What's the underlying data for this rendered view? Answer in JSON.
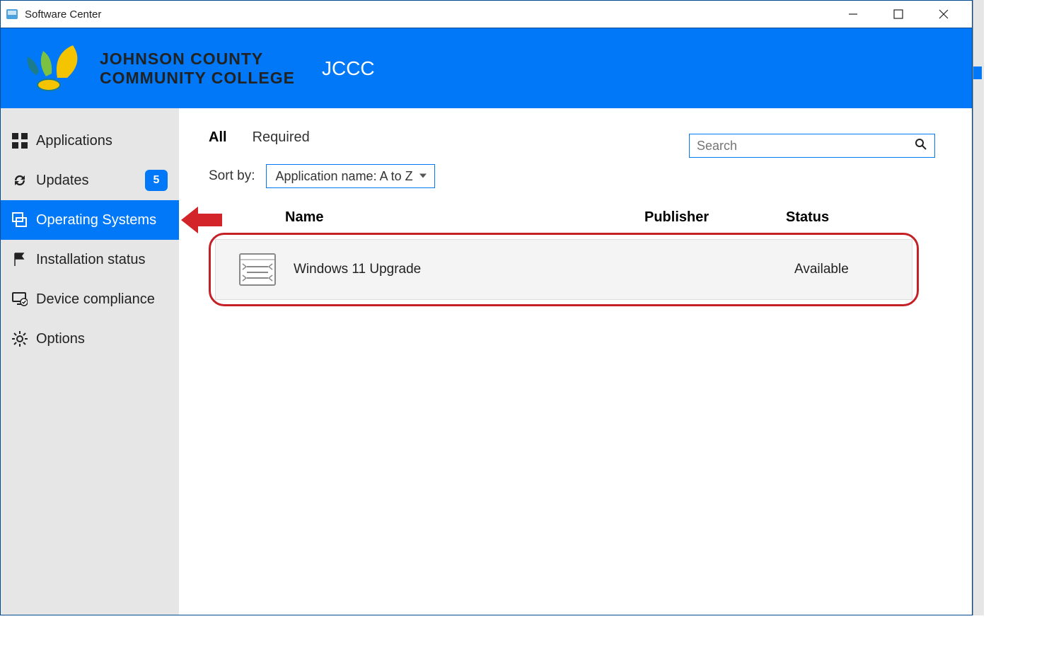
{
  "window": {
    "title": "Software Center"
  },
  "banner": {
    "logo_main": "JOHNSON COUNTY",
    "logo_sub": "COMMUNITY COLLEGE",
    "org": "JCCC"
  },
  "sidebar": {
    "items": [
      {
        "label": "Applications",
        "icon": "apps-grid-icon",
        "active": false,
        "badge": null
      },
      {
        "label": "Updates",
        "icon": "refresh-icon",
        "active": false,
        "badge": "5"
      },
      {
        "label": "Operating Systems",
        "icon": "os-stack-icon",
        "active": true,
        "badge": null
      },
      {
        "label": "Installation status",
        "icon": "flag-icon",
        "active": false,
        "badge": null
      },
      {
        "label": "Device compliance",
        "icon": "monitor-check-icon",
        "active": false,
        "badge": null
      },
      {
        "label": "Options",
        "icon": "gear-icon",
        "active": false,
        "badge": null
      }
    ]
  },
  "filters": {
    "tabs": [
      {
        "label": "All",
        "active": true
      },
      {
        "label": "Required",
        "active": false
      }
    ],
    "search_placeholder": "Search",
    "sort_label": "Sort by:",
    "sort_value": "Application name: A to Z"
  },
  "columns": {
    "name": "Name",
    "publisher": "Publisher",
    "status": "Status"
  },
  "rows": [
    {
      "name": "Windows 11 Upgrade",
      "publisher": "",
      "status": "Available"
    }
  ]
}
